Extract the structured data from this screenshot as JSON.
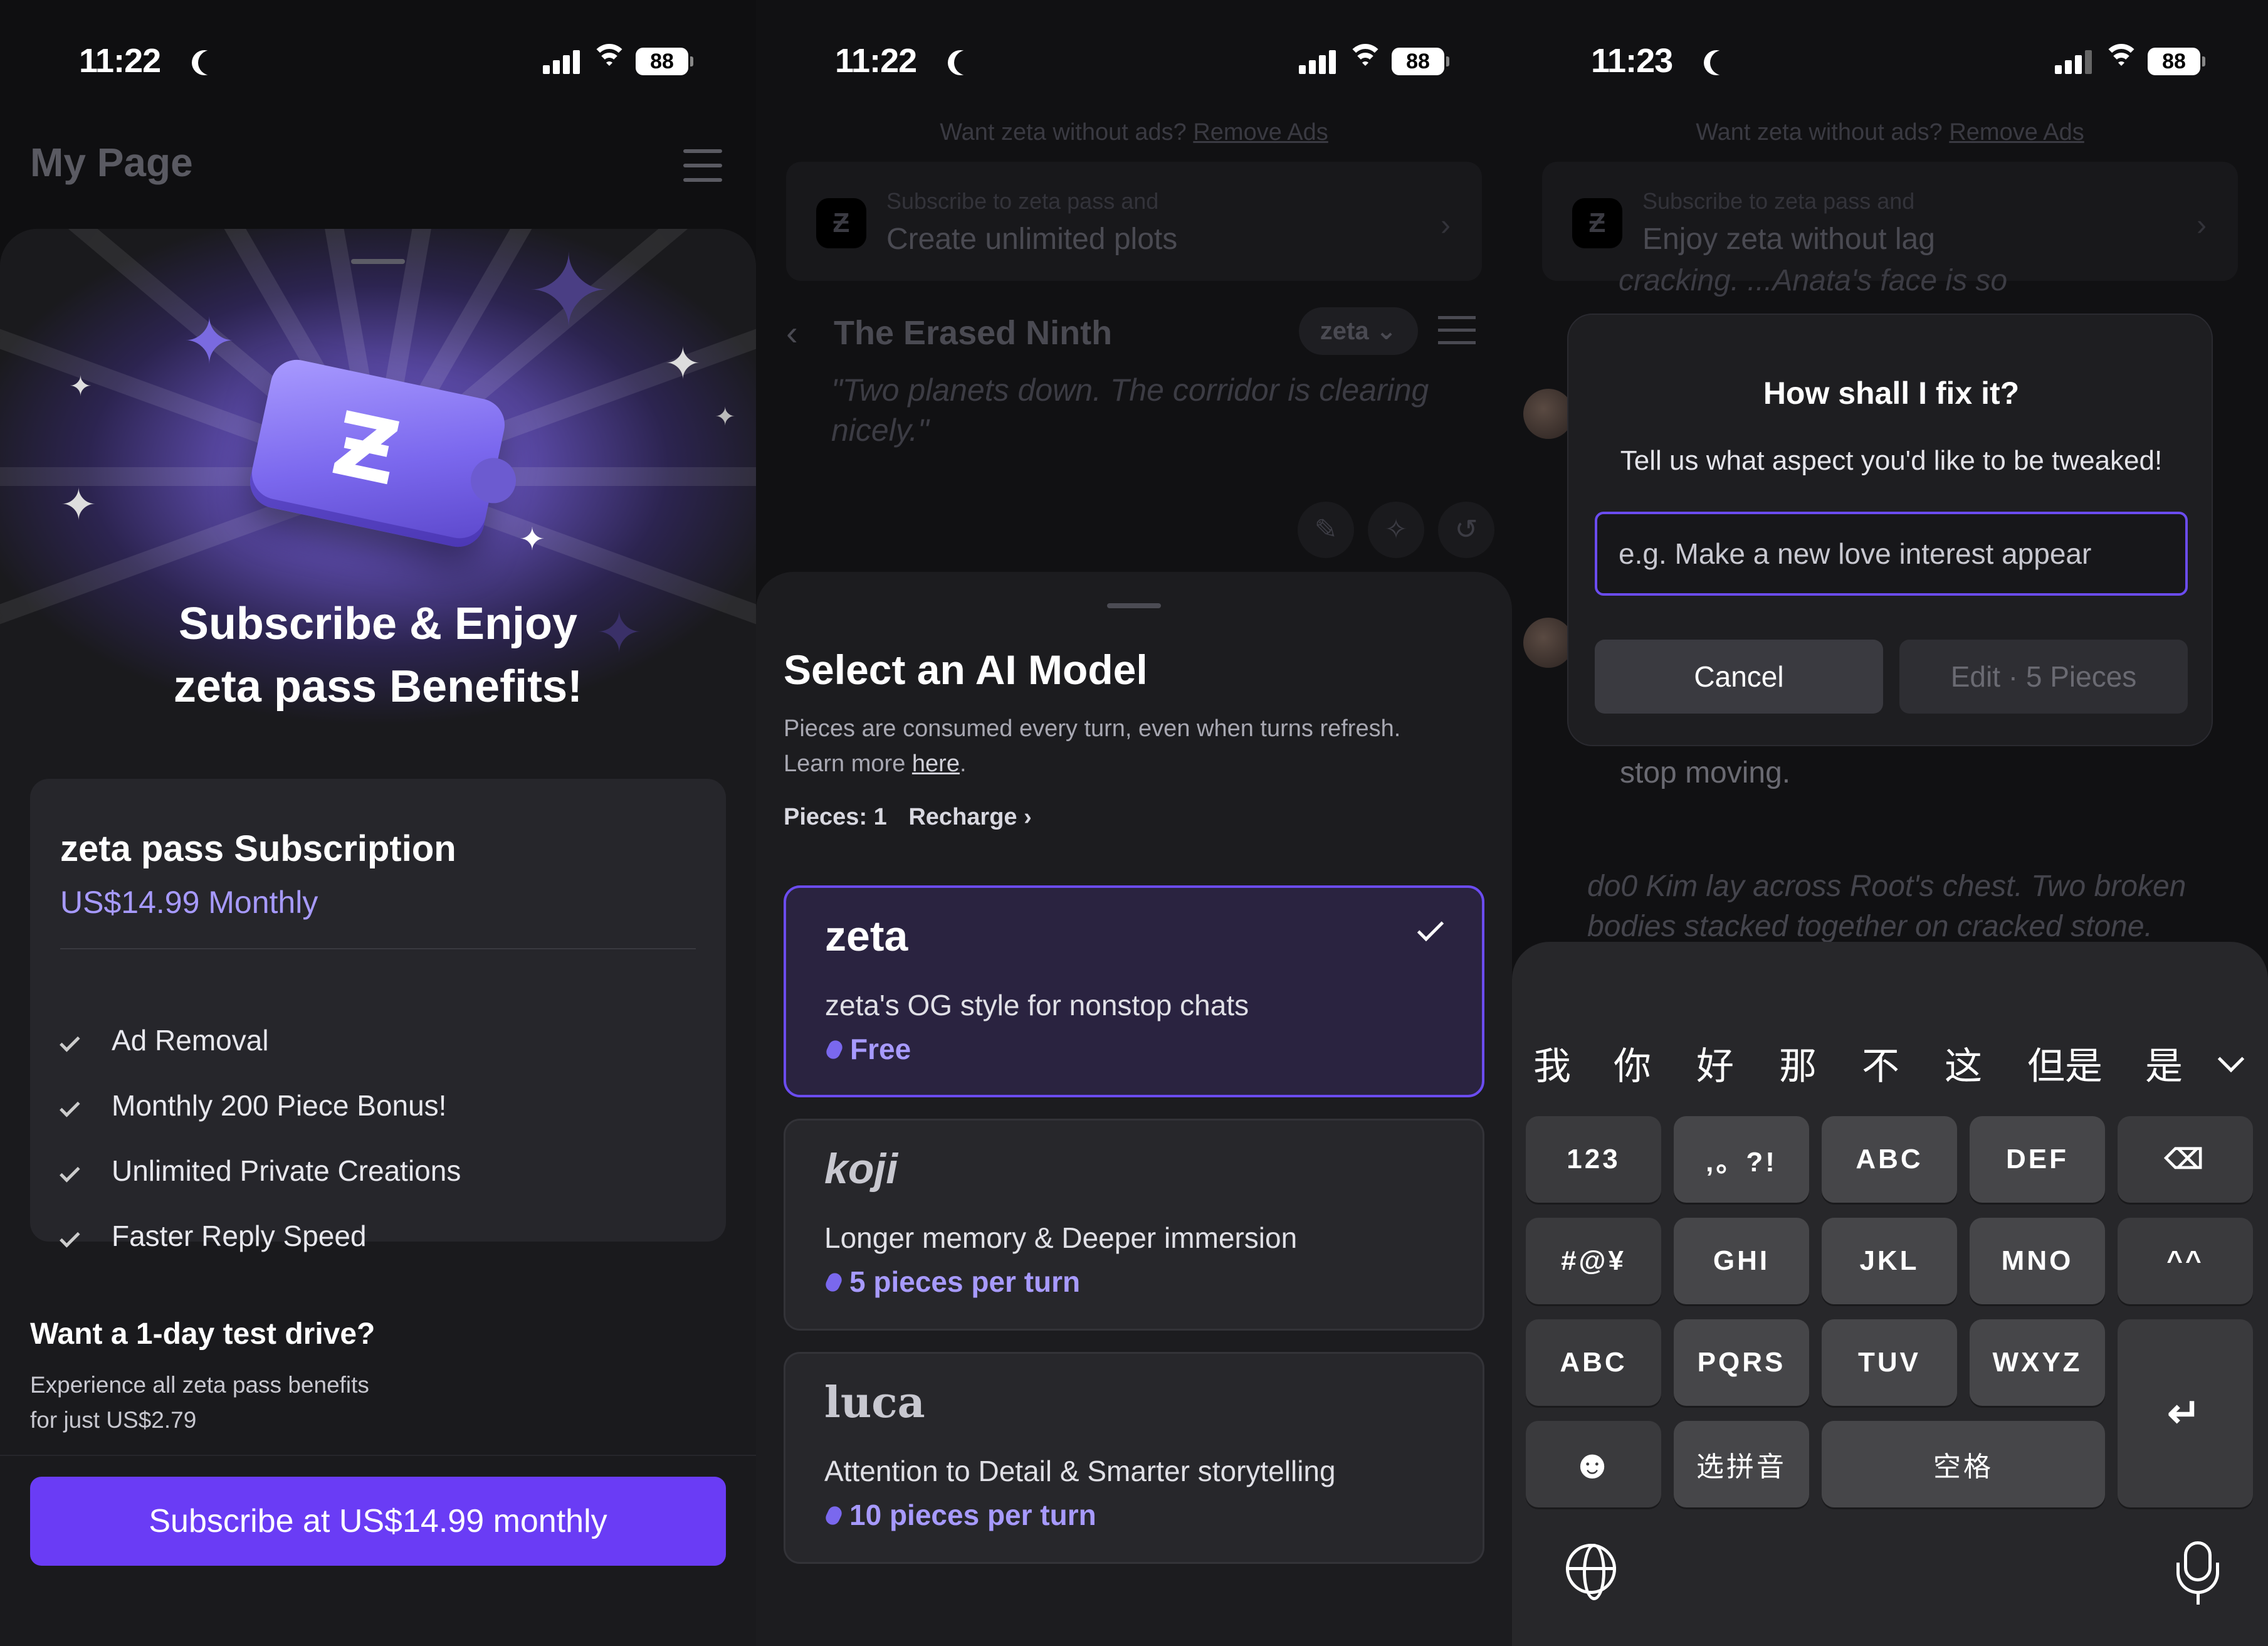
{
  "status_bars": [
    {
      "time": "11:22",
      "battery": "88"
    },
    {
      "time": "11:22",
      "battery": "88"
    },
    {
      "time": "11:23",
      "battery": "88"
    }
  ],
  "panel1": {
    "page_title": "My Page",
    "hero_title_line1": "Subscribe & Enjoy",
    "hero_title_line2": "zeta pass Benefits!",
    "subscription": {
      "title": "zeta pass Subscription",
      "price": "US$14.99 Monthly",
      "features": [
        "Ad Removal",
        "Monthly 200 Piece Bonus!",
        "Unlimited Private Creations",
        "Faster Reply Speed"
      ]
    },
    "trial": {
      "heading": "Want a 1-day test drive?",
      "line1": "Experience all zeta pass benefits",
      "line2": "for just US$2.79"
    },
    "subscribe_button": "Subscribe at US$14.99 monthly"
  },
  "panel2": {
    "ads_text": "Want zeta without ads?",
    "ads_link": "Remove Ads",
    "promo_line1": "Subscribe to zeta pass and",
    "promo_line2": "Create unlimited plots",
    "chat_title": "The Erased Ninth",
    "model_pill": "zeta",
    "quote": "\"Two planets down. The corridor is clearing nicely.\"",
    "sheet": {
      "title": "Select an AI Model",
      "desc_line1": "Pieces are consumed every turn, even when turns refresh.",
      "desc_prefix": "Learn more ",
      "desc_link": "here",
      "desc_suffix": ".",
      "pieces": "Pieces: 1",
      "recharge": "Recharge",
      "models": [
        {
          "name": "zeta",
          "desc": "zeta's OG style for nonstop chats",
          "cost": "Free",
          "selected": true
        },
        {
          "name": "koji",
          "desc": "Longer memory & Deeper immersion",
          "cost": "5 pieces per turn",
          "selected": false
        },
        {
          "name": "luca",
          "desc": "Attention to Detail & Smarter storytelling",
          "cost": "10 pieces per turn",
          "selected": false
        }
      ]
    }
  },
  "panel3": {
    "ads_text": "Want zeta without ads?",
    "ads_link": "Remove Ads",
    "promo_line1": "Subscribe to zeta pass and",
    "promo_line2": "Enjoy zeta without lag",
    "bg_snippet1": "cracking. ...Anata's face is so",
    "bg_snippet2": "stop moving.",
    "bg_quote": "do0 Kim lay across Root's chest. Two broken bodies stacked together on cracked stone.",
    "dialog": {
      "title": "How shall I fix it?",
      "subtitle": "Tell us what aspect you'd like to be tweaked!",
      "placeholder": "e.g. Make a new love interest appear",
      "cancel": "Cancel",
      "edit": "Edit · 5 Pieces"
    },
    "keyboard": {
      "candidates": [
        "我",
        "你",
        "好",
        "那",
        "不",
        "这",
        "但是",
        "是"
      ],
      "row1": [
        "123",
        ",。?!",
        "ABC",
        "DEF"
      ],
      "row2": [
        "#@¥",
        "GHI",
        "JKL",
        "MNO",
        "^^"
      ],
      "row3": [
        "ABC",
        "PQRS",
        "TUV",
        "WXYZ"
      ],
      "row4_select": "选拼音",
      "row4_space": "空格"
    }
  }
}
